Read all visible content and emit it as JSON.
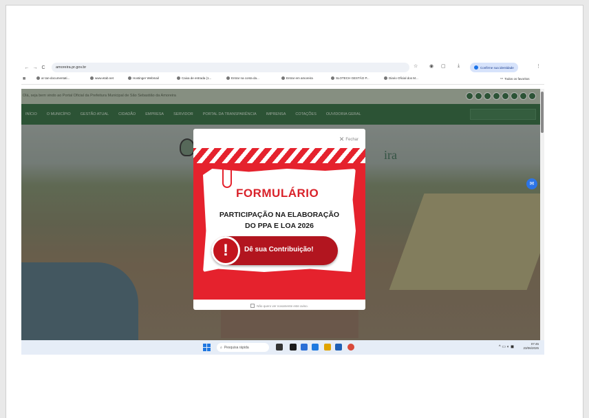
{
  "browser": {
    "url": "amoreira.pr.gov.br",
    "nav_back": "←",
    "nav_fwd": "→",
    "reload": "C",
    "confirm_label": "Confirme sua identidade",
    "menu_dots": "⋮"
  },
  "bookmarks": [
    "ar tan-documentati...",
    "www.etab.net",
    "Hostinger Webmail",
    "Caixa de entrada (1...",
    "Entrar na conta da...",
    "Entrar em amoreira",
    "SLOTECH GESTÃO P...",
    "Diario Oficial dos M...",
    "Todos os favoritos"
  ],
  "site": {
    "welcome": "Olá, seja bem vindo ao Portal Oficial da Prefeitura Municipal de São Sebastião da Amoreira",
    "menu": [
      "INÍCIO",
      "O MUNICÍPIO",
      "GESTÃO ATUAL",
      "CIDADÃO",
      "EMPRESA",
      "SERVIDOR",
      "PORTAL DA TRANSPARÊNCIA",
      "IMPRENSA",
      "COTAÇÕES",
      "OUVIDORIA GERAL"
    ],
    "title_fragment": "ira"
  },
  "modal": {
    "close_label": "Fechar",
    "title": "FORMULÁRIO",
    "subtitle_line1": "PARTICIPAÇÃO NA ELABORAÇÃO",
    "subtitle_line2": "DO PPA E LOA 2026",
    "cta": "Dê sua Contribuição!",
    "dont_show": "Não quero ver novamente este aviso."
  },
  "taskbar": {
    "search_placeholder": "Pesquisa rápida",
    "time": "07:45",
    "date": "23/06/2025"
  },
  "colors": {
    "brand_green": "#2f6b3d",
    "modal_red": "#e5222d",
    "cta_red": "#b2151f"
  }
}
